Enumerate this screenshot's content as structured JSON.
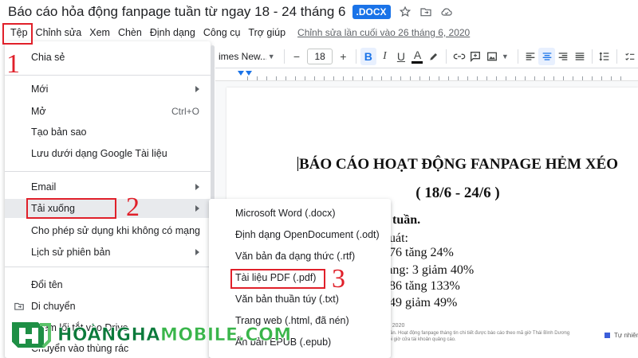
{
  "title_bar": {
    "doc_title": "Báo cáo hỏa động fanpage tuần từ ngay 18 - 24 tháng 6",
    "ext_badge": ".DOCX",
    "icons": [
      "star-icon",
      "folder-move-icon",
      "cloud-icon"
    ]
  },
  "menubar": {
    "items": [
      "Tệp",
      "Chỉnh sửa",
      "Xem",
      "Chèn",
      "Định dạng",
      "Công cụ",
      "Trợ giúp"
    ],
    "last_edit": "Chỉnh sửa lần cuối vào 26 tháng 6, 2020"
  },
  "toolbar": {
    "font_name": "imes New...",
    "font_size": "18",
    "decrease": "−",
    "increase": "+",
    "bold": "B",
    "italic": "I",
    "underline": "U",
    "text_color": "A"
  },
  "file_menu": {
    "share": "Chia sẻ",
    "new": "Mới",
    "open": "Mở",
    "open_shortcut": "Ctrl+O",
    "copy": "Tạo bản sao",
    "save_as_google": "Lưu dưới dạng Google Tài liệu",
    "email": "Email",
    "download": "Tải xuống",
    "offline": "Cho phép sử dụng khi không có mạng",
    "version_history": "Lịch sử phiên bản",
    "rename": "Đổi tên",
    "move": "Di chuyển",
    "add_shortcut": "Thêm lối tắt vào Drive",
    "trash": "Chuyển vào thùng rác"
  },
  "download_menu": {
    "items": [
      "Microsoft Word (.docx)",
      "Định dạng OpenDocument (.odt)",
      "Văn bản đa dạng thức (.rtf)",
      "Tài liệu PDF (.pdf)",
      "Văn bản thuần túy (.txt)",
      "Trang web (.html, đã nén)",
      "Ấn bản EPUB (.epub)"
    ]
  },
  "document": {
    "heading": "BÁO CÁO HOẠT ĐỘNG FANPAGE HẺM XÉO",
    "subheading": "( 18/6 - 24/6 )",
    "lines": [
      "g tuần.",
      "quát:",
      "576 tăng 24%",
      "rang: 3 giảm 40%",
      "186 tăng 133%",
      "049 giảm 49%"
    ],
    "footnote_date": "6, 2020",
    "footnote_1": "tuần. Hoạt động fanpage tháng tin chi tiết được báo cáo theo mã giờ Thái Bình Dương",
    "footnote_2": "nội giờ cửa tài khoản quảng cáo.",
    "legend": "Tự nhiên"
  },
  "annotations": {
    "step1": "1",
    "step2": "2",
    "step3": "3",
    "color": "#e0202a"
  },
  "watermark": {
    "part1": "HOÀNGHA",
    "part2": "MOBILE.COM"
  },
  "colors": {
    "accent": "#1a73e8",
    "annotation_red": "#e0202a",
    "watermark_green": "#2e9e4e"
  }
}
